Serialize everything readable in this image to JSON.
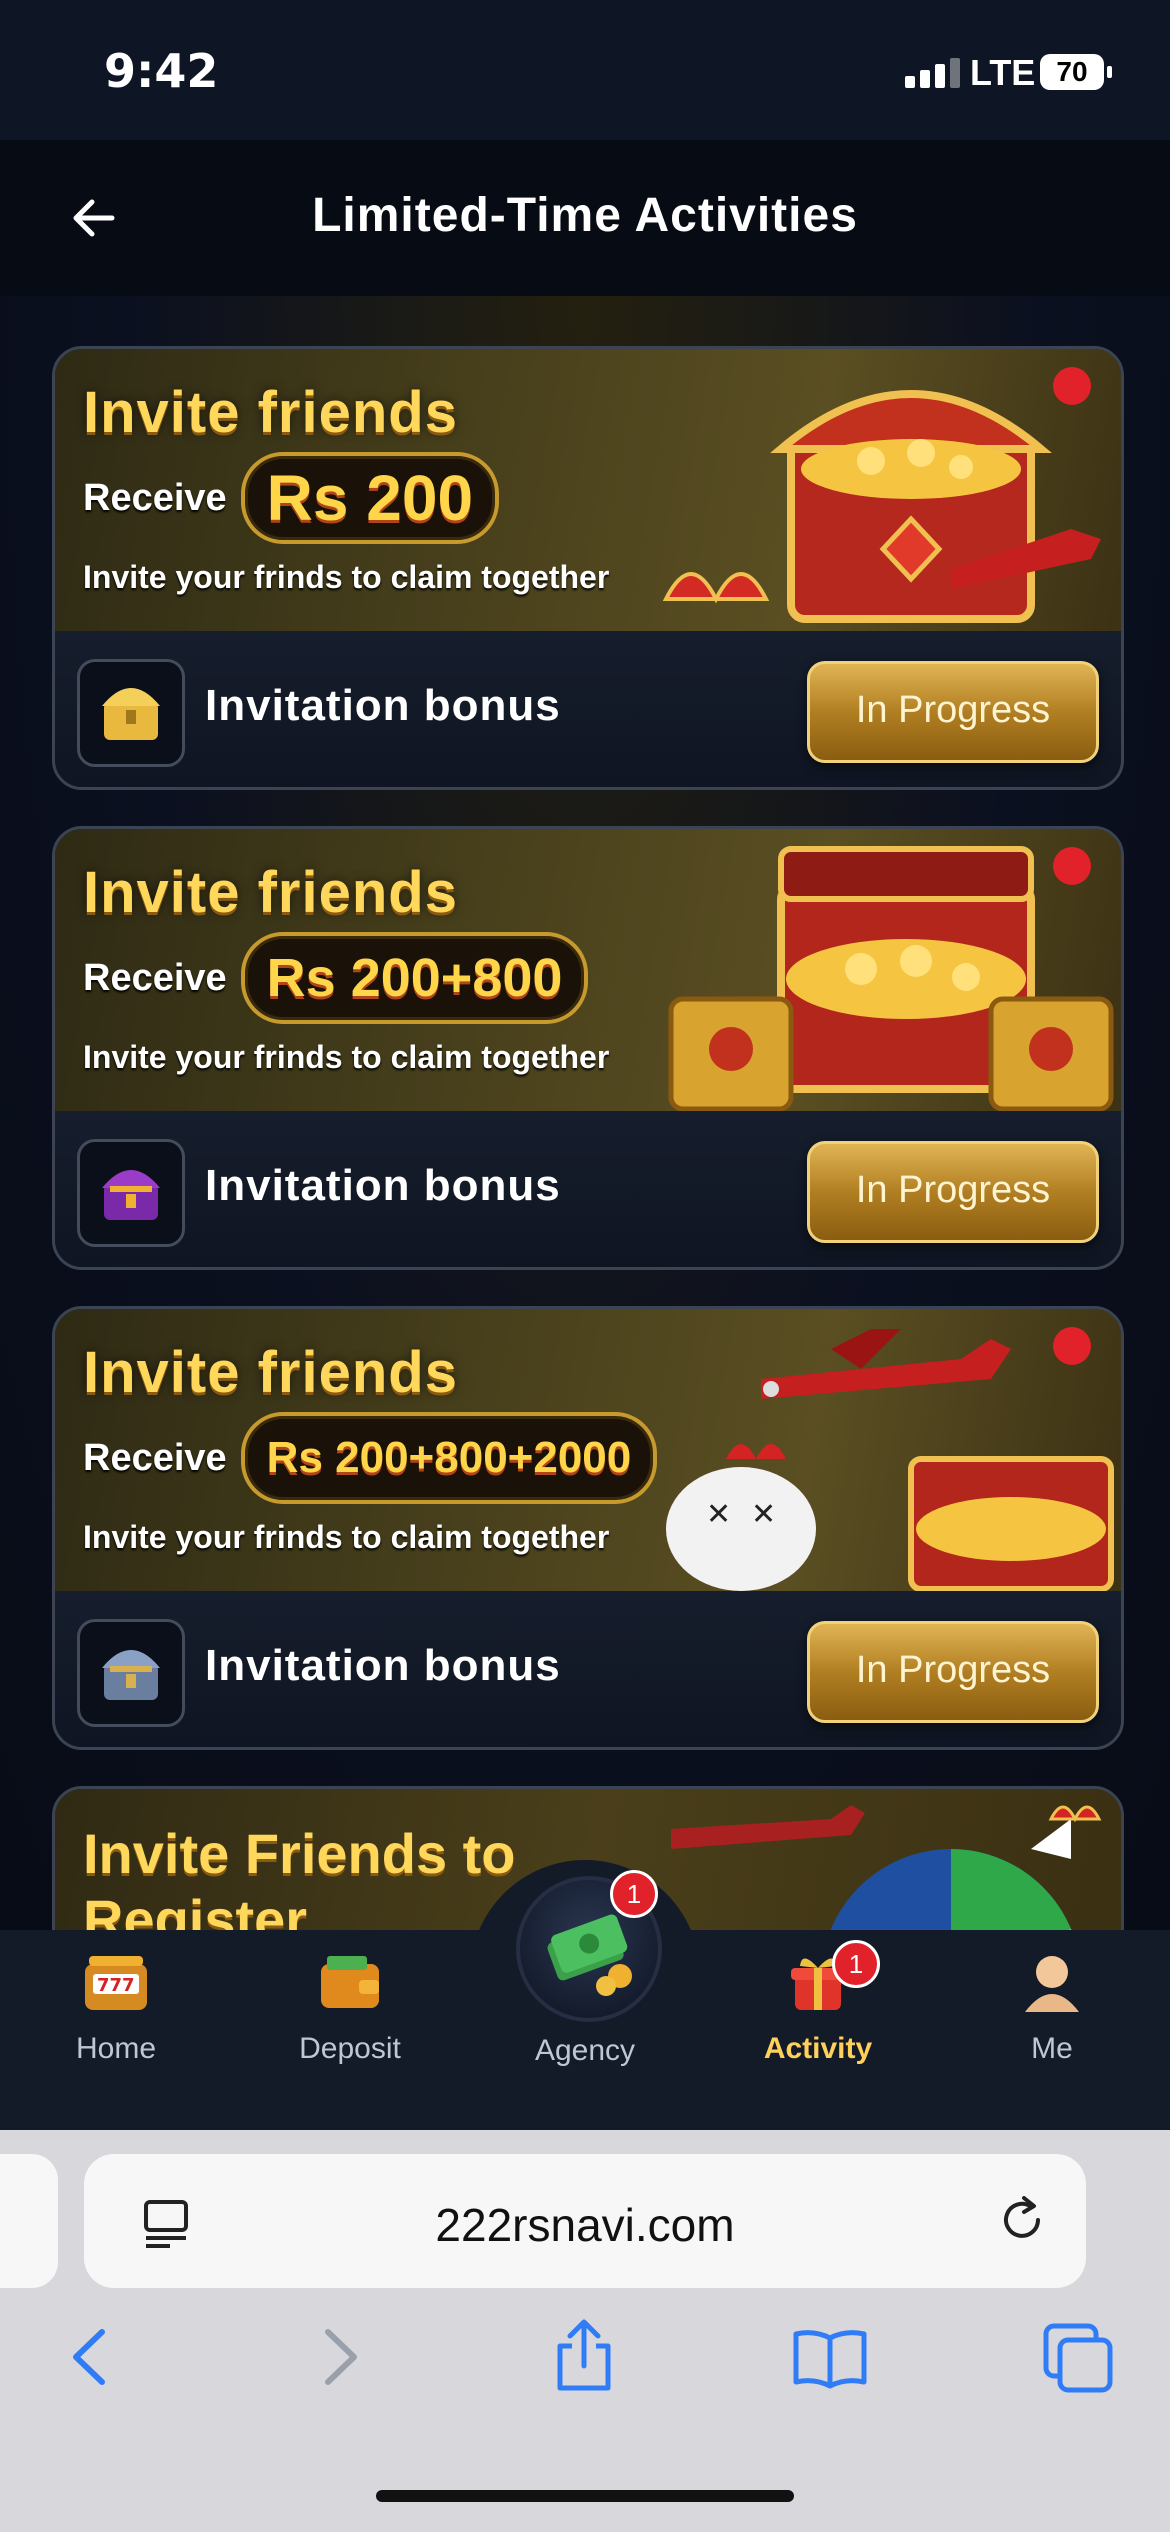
{
  "status_bar": {
    "time": "9:42",
    "network": "LTE",
    "battery": "70"
  },
  "header": {
    "title": "Limited-Time Activities"
  },
  "cards": [
    {
      "banner_title": "Invite friends",
      "receive_label": "Receive",
      "amount": "Rs 200",
      "subtitle": "Invite your frinds to claim together",
      "bonus_label": "Invitation bonus",
      "button_label": "In Progress"
    },
    {
      "banner_title": "Invite friends",
      "receive_label": "Receive",
      "amount": "Rs 200+800",
      "subtitle": "Invite your frinds to claim together",
      "bonus_label": "Invitation bonus",
      "button_label": "In Progress"
    },
    {
      "banner_title": "Invite friends",
      "receive_label": "Receive",
      "amount": "Rs 200+800+2000",
      "subtitle": "Invite your frinds to claim together",
      "bonus_label": "Invitation bonus",
      "button_label": "In Progress"
    },
    {
      "banner_title": "Invite Friends to Register"
    }
  ],
  "tabbar": {
    "items": [
      {
        "label": "Home",
        "icon": "slot-machine-icon"
      },
      {
        "label": "Deposit",
        "icon": "wallet-icon"
      },
      {
        "label": "Agency",
        "icon": "cash-icon",
        "badge": "1"
      },
      {
        "label": "Activity",
        "icon": "gift-icon",
        "badge": "1",
        "active": true
      },
      {
        "label": "Me",
        "icon": "person-icon"
      }
    ]
  },
  "browser": {
    "url": "222rsnavi.com"
  },
  "colors": {
    "accent_gold": "#ffd05a",
    "badge_red": "#e2222a",
    "header_bg": "#070b14"
  }
}
